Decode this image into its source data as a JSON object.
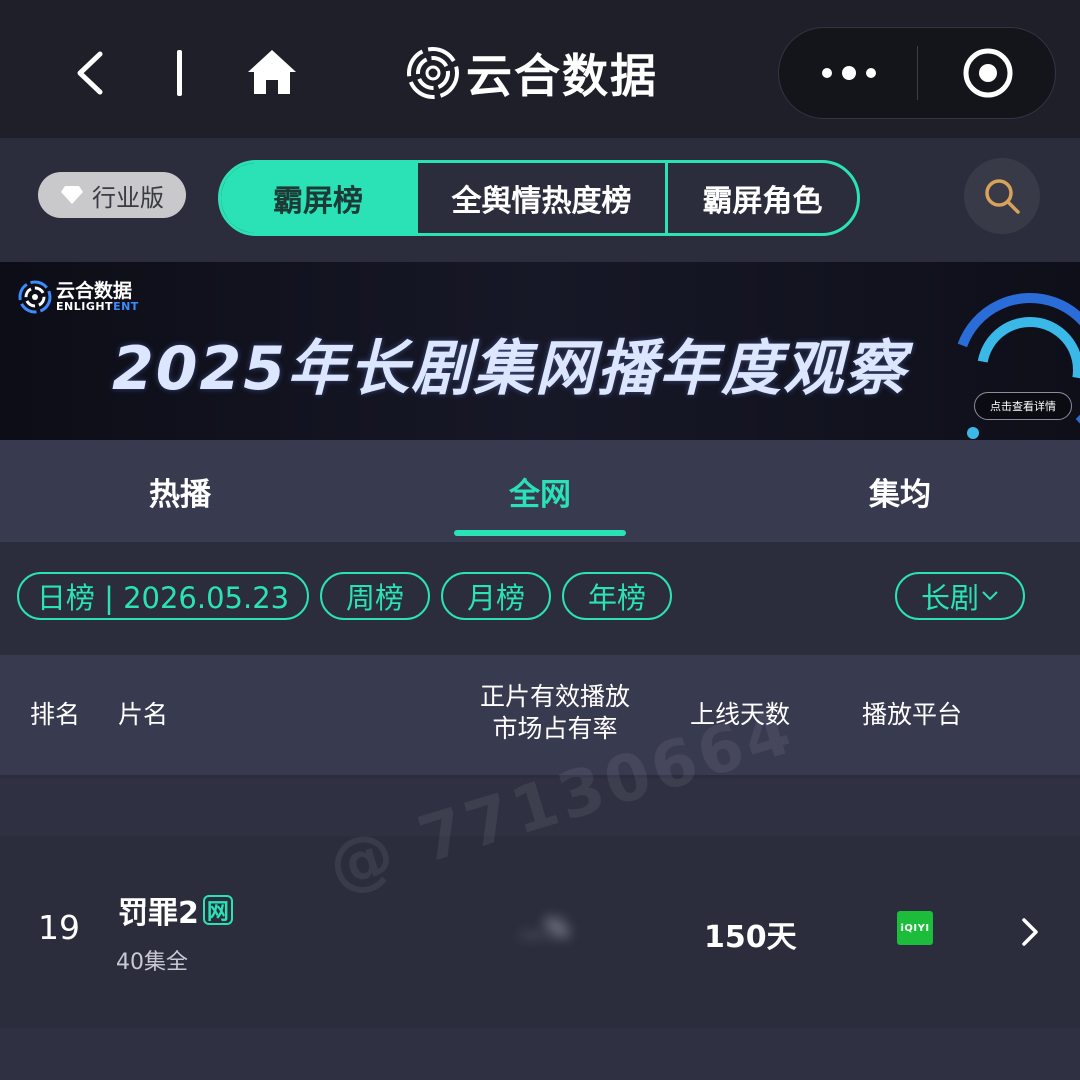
{
  "nav": {
    "title": "云合数据"
  },
  "filters": {
    "edition_label": "行业版",
    "segments": [
      {
        "label": "霸屏榜",
        "active": true
      },
      {
        "label": "全舆情热度榜",
        "active": false
      },
      {
        "label": "霸屏角色",
        "active": false
      }
    ]
  },
  "banner": {
    "brand_cn": "云合数据",
    "brand_en_a": "ENLIGHT",
    "brand_en_b": "ENT",
    "title": "2025年长剧集网播年度观察",
    "detail_label": "点击查看详情"
  },
  "tabs": [
    {
      "label": "热播",
      "active": false
    },
    {
      "label": "全网",
      "active": true
    },
    {
      "label": "集均",
      "active": false
    }
  ],
  "chips": {
    "daily": "日榜 | 2026.05.23",
    "weekly": "周榜",
    "monthly": "月榜",
    "yearly": "年榜",
    "category": "长剧"
  },
  "table": {
    "headers": {
      "rank": "排名",
      "title": "片名",
      "share_line1": "正片有效播放",
      "share_line2": "市场占有率",
      "days": "上线天数",
      "platform": "播放平台"
    },
    "rows": [
      {
        "rank": "19",
        "title": "罚罪2",
        "tag": "网",
        "episodes": "40集全",
        "share": "...%",
        "days": "150天",
        "platform": "iQIYI"
      }
    ]
  },
  "watermark": "@ 77130664",
  "colors": {
    "accent": "#2ae2b6",
    "top_bar": "#1f1f29",
    "background": "#2b2d3d",
    "header_bg": "#383a50",
    "platform_green": "#1bbd3b"
  },
  "icons": [
    "back-icon",
    "home-icon",
    "yunhe-logo-icon",
    "more-icon",
    "close-circle-icon",
    "gem-icon",
    "search-icon",
    "chevron-down-icon",
    "chevron-right-icon"
  ]
}
